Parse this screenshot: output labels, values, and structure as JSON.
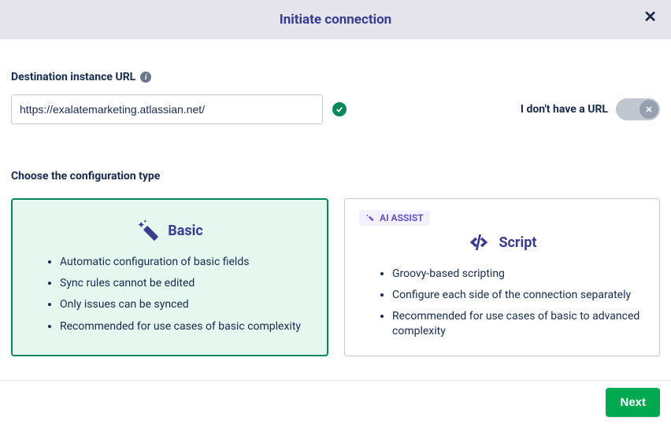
{
  "header": {
    "title": "Initiate connection",
    "close": "✕"
  },
  "url_section": {
    "label": "Destination instance URL",
    "value": "https://exalatemarketing.atlassian.net/",
    "no_url_label": "I don't have a URL"
  },
  "config_section": {
    "label": "Choose the configuration type"
  },
  "cards": {
    "basic": {
      "title": "Basic",
      "bullets": [
        "Automatic configuration of basic fields",
        "Sync rules cannot be edited",
        "Only issues can be synced",
        "Recommended for use cases of basic complexity"
      ]
    },
    "script": {
      "badge": "AI ASSIST",
      "title": "Script",
      "bullets": [
        "Groovy-based scripting",
        "Configure each side of the connection separately",
        "Recommended for use cases of basic to advanced complexity"
      ]
    }
  },
  "footer": {
    "next": "Next"
  }
}
